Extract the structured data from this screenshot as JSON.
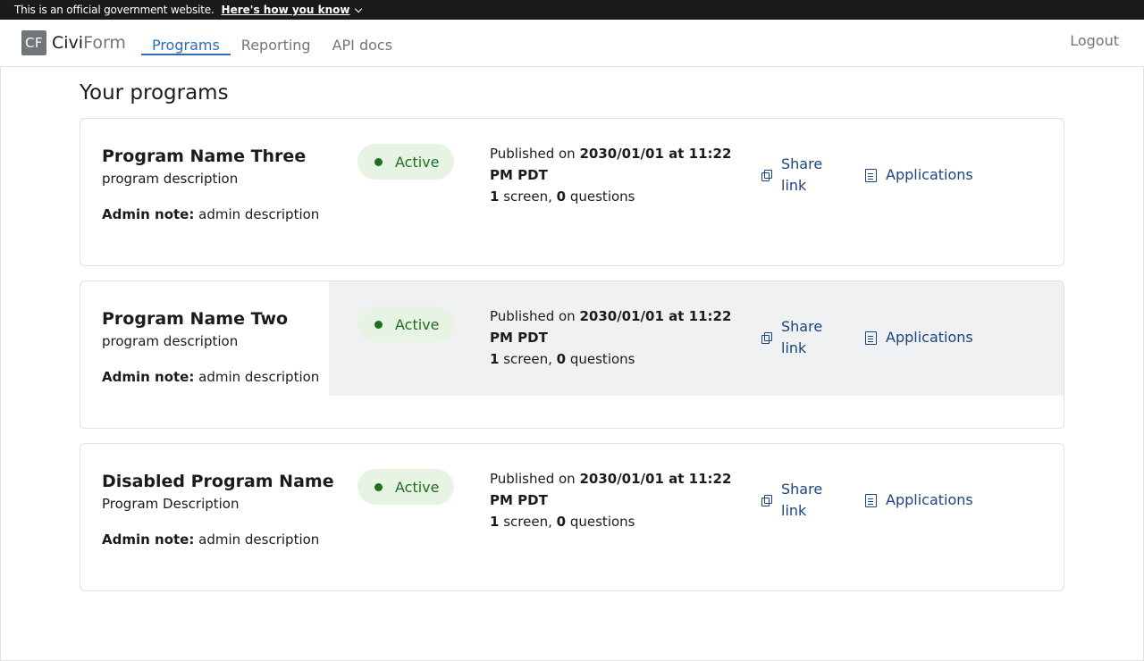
{
  "banner": {
    "text": "This is an official government website.",
    "link": "Here's how you know"
  },
  "nav": {
    "logo_mark": "CF",
    "logo_civi": "Civi",
    "logo_form": "Form",
    "links": [
      "Programs",
      "Reporting",
      "API docs"
    ],
    "active_index": 0,
    "logout": "Logout"
  },
  "main": {
    "title": "Your programs",
    "programs": [
      {
        "name": "Program Name Three",
        "description": "program description",
        "admin_note_label": "Admin note:",
        "admin_note": "admin description",
        "status": "Active",
        "published_prefix": "Published on",
        "published_date": "2030/01/01 at 11:22 PM PDT",
        "screens_count": "1",
        "screens_label": "screen,",
        "questions_count": "0",
        "questions_label": "questions",
        "share_label": "Share link",
        "applications_label": "Applications"
      },
      {
        "name": "Program Name Two",
        "description": "program description",
        "admin_note_label": "Admin note:",
        "admin_note": "admin description",
        "status": "Active",
        "published_prefix": "Published on",
        "published_date": "2030/01/01 at 11:22 PM PDT",
        "screens_count": "1",
        "screens_label": "screen,",
        "questions_count": "0",
        "questions_label": "questions",
        "share_label": "Share link",
        "applications_label": "Applications"
      },
      {
        "name": "Disabled Program Name",
        "description": "Program Description",
        "admin_note_label": "Admin note:",
        "admin_note": "admin description",
        "status": "Active",
        "published_prefix": "Published on",
        "published_date": "2030/01/01 at 11:22 PM PDT",
        "screens_count": "1",
        "screens_label": "screen,",
        "questions_count": "0",
        "questions_label": "questions",
        "share_label": "Share link",
        "applications_label": "Applications"
      }
    ]
  },
  "colors": {
    "accent": "#2e6ab4",
    "link": "#1a4480",
    "active_green": "#216e1f",
    "active_bg": "#e7f4e4",
    "banner_bg": "#1b1b1b"
  }
}
